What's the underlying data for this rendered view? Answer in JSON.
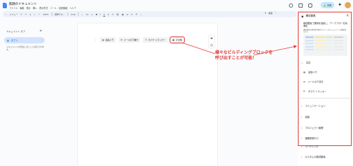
{
  "header": {
    "title": "無題のドキュメント",
    "menu": [
      "ファイル",
      "編集",
      "表示",
      "挿入",
      "表示形式",
      "ツール",
      "拡張機能",
      "ヘルプ"
    ],
    "share_label": "共有"
  },
  "toolbar": {
    "search_label": "メニュー",
    "zoom": "100%",
    "style": "標準テキ...",
    "font": "Arial",
    "font_size": "11",
    "mode_label": "編集"
  },
  "sidebar": {
    "title": "ドキュメント タブ",
    "tab_label": "タブ 1",
    "description": "ドキュメントの見出しがここに表示されます。"
  },
  "document": {
    "chips": [
      {
        "icon": "note-icon",
        "label": "会議メモ"
      },
      {
        "icon": "mail-icon",
        "label": "メールの下書き"
      },
      {
        "icon": "tasks-icon",
        "label": "タスク トラッカー"
      },
      {
        "icon": "other-icon",
        "label": "その他"
      }
    ]
  },
  "annotation": {
    "line1": "様々なビルディングブロックを",
    "line2": "呼び出すことが可能！"
  },
  "panel": {
    "title": "構成要素",
    "intro": "構成要素で関係を強化し、ワークフローを効率化",
    "intro_small": "構成要素は再利用可能なスマートなドキュメントの構成単位です",
    "featured_header": "注目",
    "featured_items": [
      {
        "icon": "note-icon",
        "label": "会議メモ"
      },
      {
        "icon": "mail-icon",
        "label": "メールの下書き"
      },
      {
        "icon": "tasks-icon",
        "label": "タスク トラッカー"
      }
    ],
    "sections": [
      "コミュニケーション",
      "会議",
      "プロジェクト管理",
      "価格見積もり",
      "コーディング",
      "カスタムの構成要素"
    ]
  },
  "colors": {
    "accent": "#0b57d0",
    "annotation_red": "#e53935",
    "share_bg": "#c2e7ff"
  }
}
